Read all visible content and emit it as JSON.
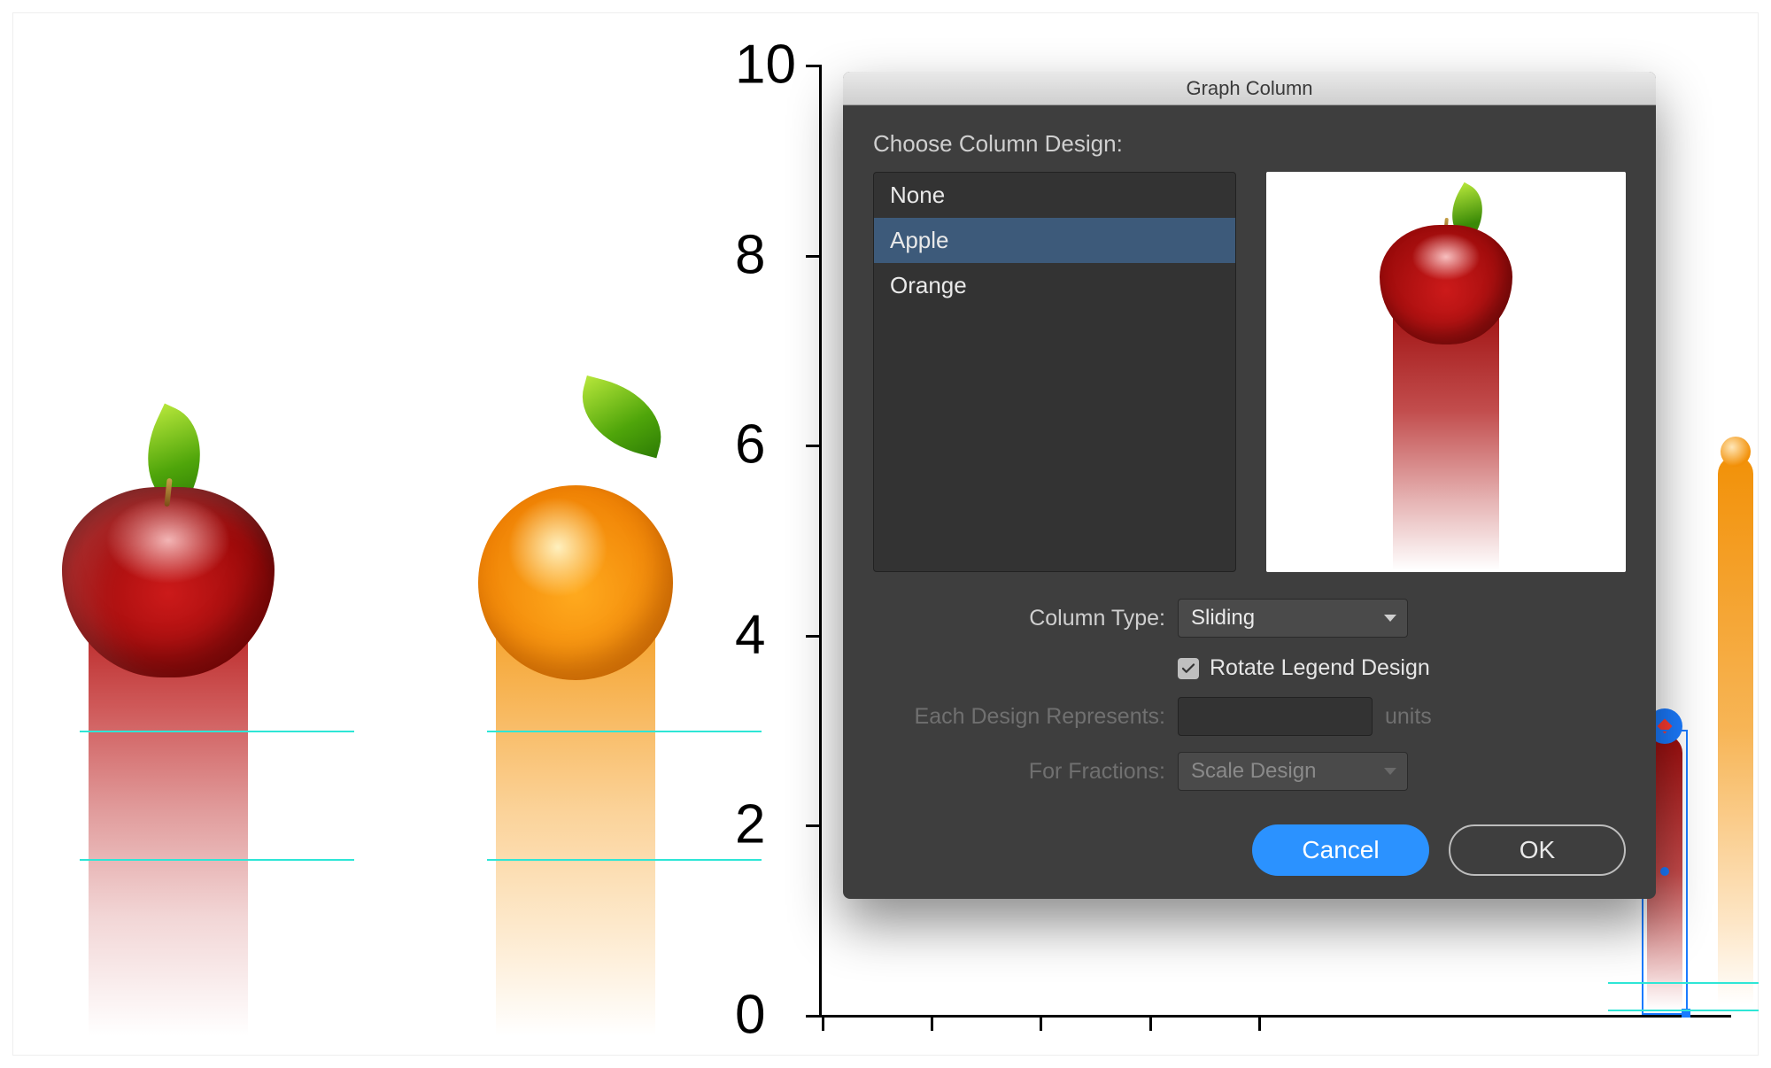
{
  "dialog": {
    "title": "Graph Column",
    "choose_label": "Choose Column Design:",
    "items": [
      "None",
      "Apple",
      "Orange"
    ],
    "selected_index": 1,
    "column_type_label": "Column Type:",
    "column_type_value": "Sliding",
    "rotate_legend_label": "Rotate Legend Design",
    "rotate_legend_checked": true,
    "each_design_label": "Each Design Represents:",
    "each_design_units": "units",
    "for_fractions_label": "For Fractions:",
    "for_fractions_value": "Scale Design",
    "cancel": "Cancel",
    "ok": "OK"
  },
  "axis": {
    "y_ticks": [
      "0",
      "2",
      "4",
      "6",
      "8",
      "10"
    ]
  },
  "chart_data": {
    "type": "bar",
    "categories": [
      "Apple",
      "Orange"
    ],
    "values": [
      2.4,
      6.1
    ],
    "ylim": [
      0,
      10
    ],
    "title": "",
    "xlabel": "",
    "ylabel": ""
  }
}
